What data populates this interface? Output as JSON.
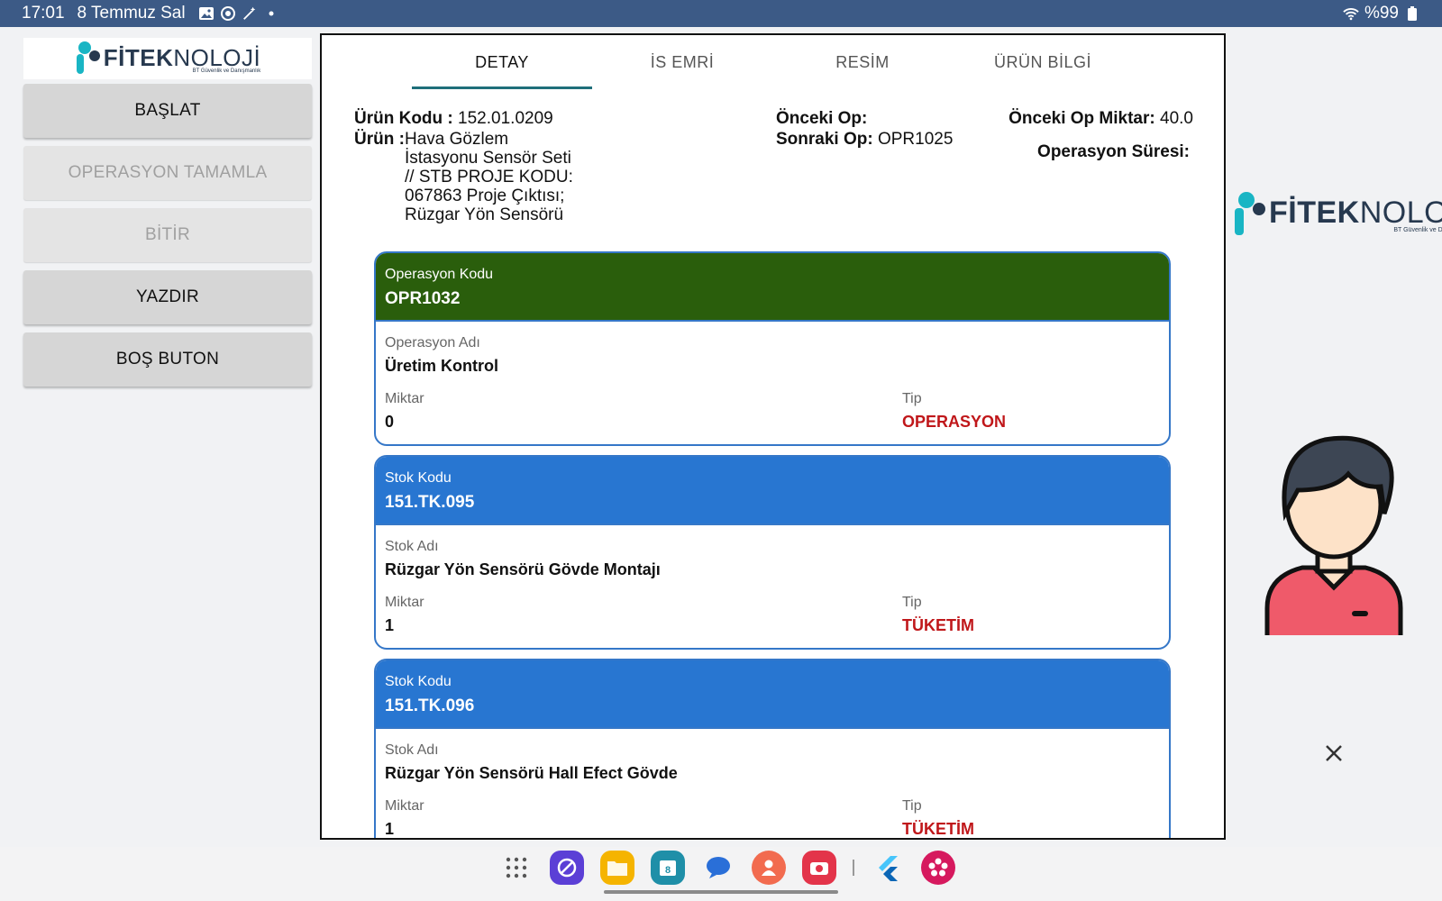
{
  "status": {
    "time": "17:01",
    "date": "8 Temmuz Sal",
    "battery": "%99"
  },
  "brand": {
    "name_bold": "FİTEK",
    "name_light": "NOLOJİ",
    "tagline": "BT Güvenlik ve Danışmanlık"
  },
  "sidebar": {
    "buttons": [
      {
        "label": "BAŞLAT",
        "enabled": true
      },
      {
        "label": "OPERASYON TAMAMLA",
        "enabled": false
      },
      {
        "label": "BİTİR",
        "enabled": false
      },
      {
        "label": "YAZDIR",
        "enabled": true
      },
      {
        "label": "BOŞ BUTON",
        "enabled": true
      }
    ]
  },
  "tabs": [
    {
      "label": "DETAY",
      "active": true
    },
    {
      "label": "İS EMRİ",
      "active": false
    },
    {
      "label": "RESİM",
      "active": false
    },
    {
      "label": "ÜRÜN BİLGİ",
      "active": false
    }
  ],
  "detail": {
    "urun_kodu_label": "Ürün Kodu :",
    "urun_kodu": "152.01.0209",
    "urun_label": "Ürün :",
    "urun": "Hava Gözlem İstasyonu Sensör Seti  // STB PROJE KODU: 067863 Proje Çıktısı; Rüzgar Yön Sensörü",
    "onceki_op_label": "Önceki Op:",
    "onceki_op": "",
    "sonraki_op_label": "Sonraki Op:",
    "sonraki_op": "OPR1025",
    "onceki_op_miktar_label": "Önceki Op Miktar:",
    "onceki_op_miktar": "40.0",
    "operasyon_suresi_label": "Operasyon Süresi:"
  },
  "cards": [
    {
      "head_label": "Operasyon Kodu",
      "head_value": "OPR1032",
      "color": "#2a5e0c",
      "name_label": "Operasyon Adı",
      "name_value": "Üretim Kontrol",
      "qty_label": "Miktar",
      "qty_value": "0",
      "tip_label": "Tip",
      "tip_value": "OPERASYON"
    },
    {
      "head_label": "Stok Kodu",
      "head_value": "151.TK.095",
      "color": "#2876d1",
      "name_label": "Stok Adı",
      "name_value": "Rüzgar Yön Sensörü Gövde Montajı",
      "qty_label": "Miktar",
      "qty_value": "1",
      "tip_label": "Tip",
      "tip_value": "TÜKETİM"
    },
    {
      "head_label": "Stok Kodu",
      "head_value": "151.TK.096",
      "color": "#2876d1",
      "name_label": "Stok Adı",
      "name_value": "Rüzgar Yön Sensörü Hall Efect Gövde",
      "qty_label": "Miktar",
      "qty_value": "1",
      "tip_label": "Tip",
      "tip_value": "TÜKETİM"
    }
  ],
  "dock": {
    "calendar_day": "8"
  },
  "icons": {
    "close": "close-icon",
    "avatar": "user-avatar-icon"
  }
}
